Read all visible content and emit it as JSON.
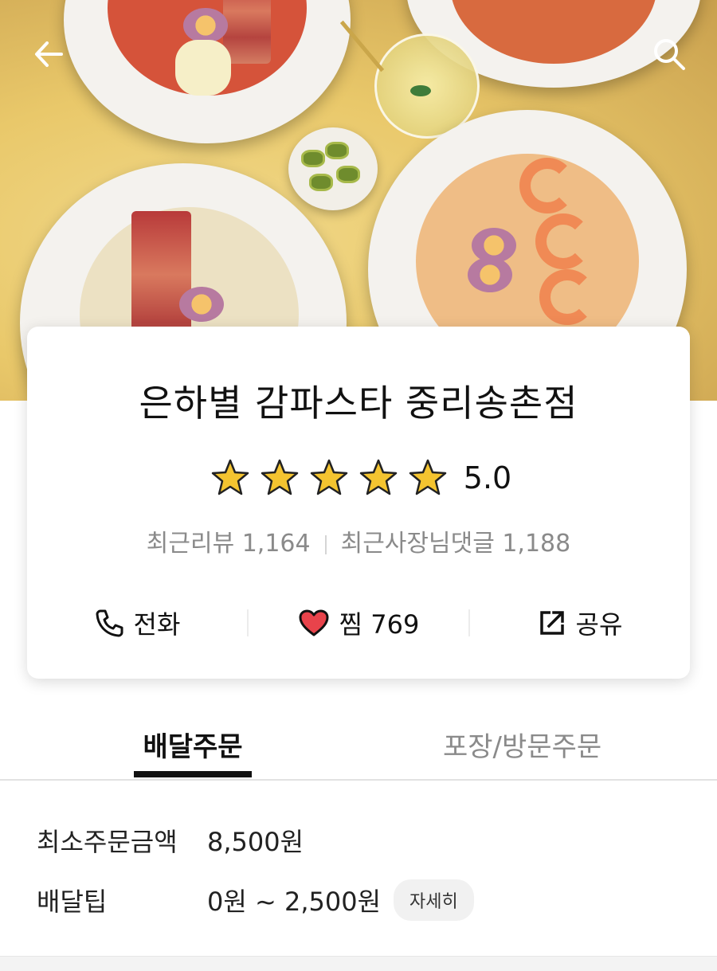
{
  "store": {
    "name": "은하별 감파스타 중리송촌점",
    "rating": "5.0",
    "stars": 5,
    "recent_reviews": "최근리뷰 1,164",
    "owner_comments": "최근사장님댓글 1,188"
  },
  "actions": {
    "call_label": "전화",
    "favorite_label": "찜 769",
    "share_label": "공유"
  },
  "tabs": {
    "delivery": "배달주문",
    "pickup": "포장/방문주문"
  },
  "delivery_info": {
    "min_order_label": "최소주문금액",
    "min_order_value": "8,500원",
    "tip_label": "배달팁",
    "tip_value": "0원 ~ 2,500원",
    "detail_button": "자세히"
  },
  "icons": {
    "back": "back-arrow-icon",
    "search": "search-icon",
    "phone": "phone-icon",
    "heart": "heart-icon",
    "share": "share-icon",
    "star": "star-icon"
  },
  "colors": {
    "star_fill": "#f4c430",
    "heart": "#e8434b",
    "hero_bg": "#e9c86a"
  }
}
